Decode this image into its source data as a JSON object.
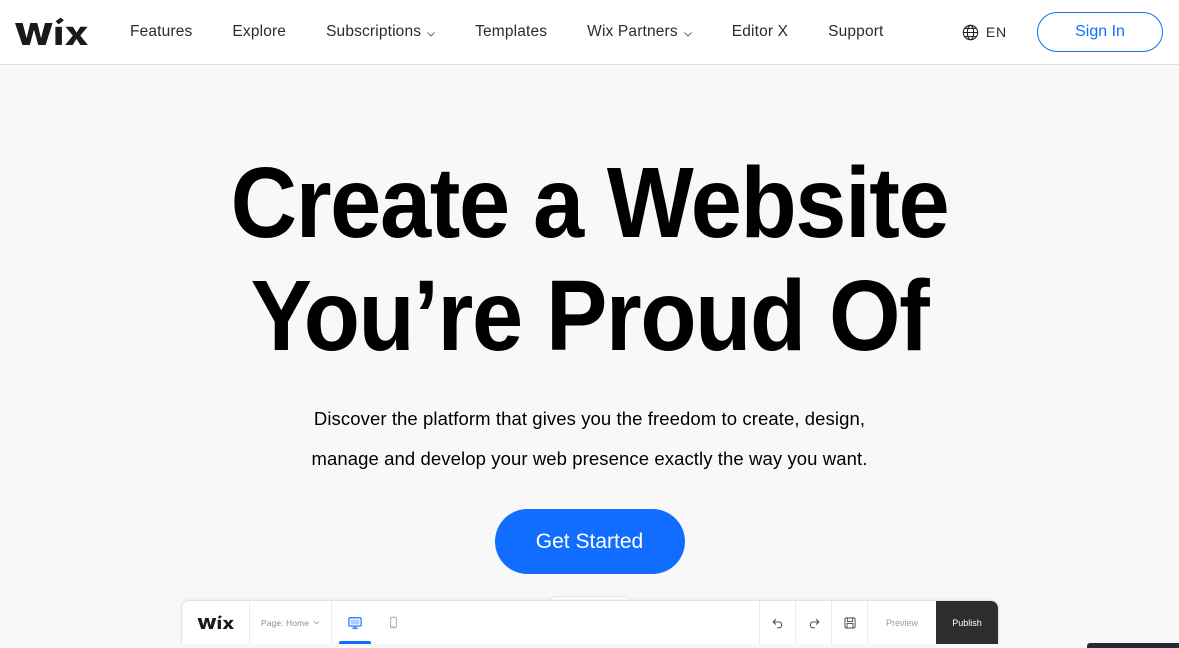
{
  "header": {
    "logo_name": "wix-logo",
    "nav_items": [
      {
        "label": "Features",
        "has_dropdown": false
      },
      {
        "label": "Explore",
        "has_dropdown": false
      },
      {
        "label": "Subscriptions",
        "has_dropdown": true
      },
      {
        "label": "Templates",
        "has_dropdown": false
      },
      {
        "label": "Wix Partners",
        "has_dropdown": true
      },
      {
        "label": "Editor X",
        "has_dropdown": false
      },
      {
        "label": "Support",
        "has_dropdown": false
      }
    ],
    "language": {
      "code": "EN",
      "icon": "globe-icon"
    },
    "sign_in_label": "Sign In"
  },
  "hero": {
    "title_line1": "Create a Website",
    "title_line2": "You’re Proud Of",
    "subtitle_line1": "Discover the platform that gives you the freedom to create, design,",
    "subtitle_line2": "manage and develop your web presence exactly the way you want.",
    "cta_label": "Get Started"
  },
  "editor": {
    "logo_name": "wix-logo",
    "page_selector": "Page: Home",
    "devices": [
      {
        "name": "desktop-view",
        "active": true
      },
      {
        "name": "mobile-view",
        "active": false
      }
    ],
    "actions": [
      {
        "name": "undo-icon"
      },
      {
        "name": "redo-icon"
      },
      {
        "name": "save-icon"
      }
    ],
    "preview_label": "Preview",
    "publish_label": "Publish"
  },
  "colors": {
    "accent_blue": "#116dff",
    "page_background": "#f8f8f8",
    "header_background": "#ffffff",
    "publish_dark": "#2e2e2e",
    "text_primary": "#000000"
  }
}
